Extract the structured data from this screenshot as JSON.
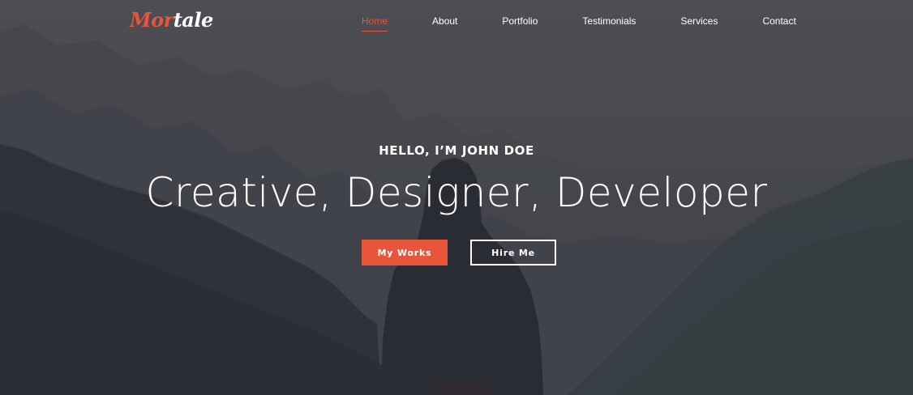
{
  "brand": {
    "logo_part1": "Mor",
    "logo_part2": "tale",
    "accent_color": "#e8553b"
  },
  "nav": {
    "items": [
      {
        "label": "Home",
        "active": true
      },
      {
        "label": "About",
        "active": false
      },
      {
        "label": "Portfolio",
        "active": false
      },
      {
        "label": "Testimonials",
        "active": false
      },
      {
        "label": "Services",
        "active": false
      },
      {
        "label": "Contact",
        "active": false
      }
    ]
  },
  "hero": {
    "greeting": "HELLO, I’M JOHN DOE",
    "headline": "Creative, Designer, Developer",
    "primary_button": "My Works",
    "secondary_button": "Hire Me"
  }
}
